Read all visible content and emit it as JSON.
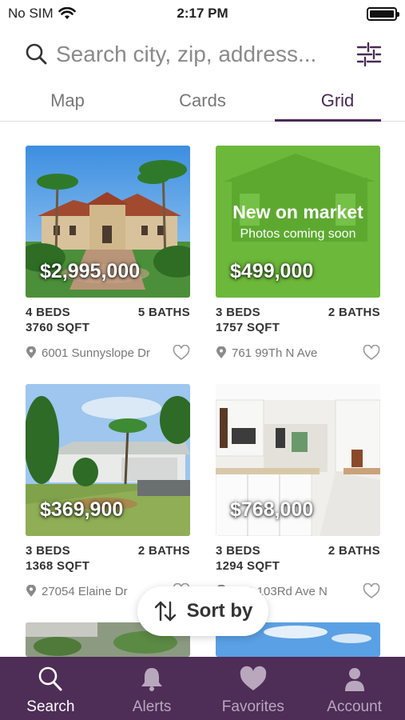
{
  "status_bar": {
    "carrier": "No SIM",
    "time": "2:17 PM"
  },
  "search": {
    "placeholder": "Search city, zip, address..."
  },
  "tabs": [
    {
      "label": "Map",
      "active": false
    },
    {
      "label": "Cards",
      "active": false
    },
    {
      "label": "Grid",
      "active": true
    }
  ],
  "listings": [
    {
      "price": "$2,995,000",
      "beds": "4 BEDS",
      "baths": "5 BATHS",
      "sqft": "3760 SQFT",
      "address": "6001 Sunnyslope Dr"
    },
    {
      "price": "$499,000",
      "beds": "3 BEDS",
      "baths": "2 BATHS",
      "sqft": "1757 SQFT",
      "address": "761 99Th N Ave",
      "photo_title": "New on market",
      "photo_subtitle": "Photos coming soon"
    },
    {
      "price": "$369,900",
      "beds": "3 BEDS",
      "baths": "2 BATHS",
      "sqft": "1368 SQFT",
      "address": "27054 Elaine Dr"
    },
    {
      "price": "$768,000",
      "beds": "3 BEDS",
      "baths": "2 BATHS",
      "sqft": "1294 SQFT",
      "address": "5N1 103Rd Ave N"
    }
  ],
  "sort": {
    "label": "Sort by"
  },
  "bottom_nav": [
    {
      "label": "Search",
      "icon": "search-icon",
      "active": true
    },
    {
      "label": "Alerts",
      "icon": "bell-icon",
      "active": false
    },
    {
      "label": "Favorites",
      "icon": "heart-icon",
      "active": false
    },
    {
      "label": "Account",
      "icon": "person-icon",
      "active": false
    }
  ],
  "colors": {
    "brand": "#4e2d57",
    "accent_green": "#6cb83a"
  }
}
